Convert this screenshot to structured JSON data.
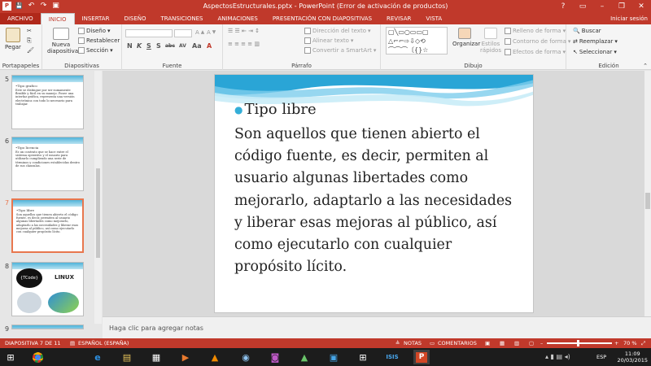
{
  "window": {
    "title": "AspectosEstructurales.pptx -  PowerPoint (Error de activación de productos)",
    "help": "?",
    "minimize": "–",
    "restore": "❐",
    "close": "✕"
  },
  "qat": {
    "save": "💾",
    "undo": "↶",
    "redo": "↷",
    "present": "▣"
  },
  "tabs": [
    {
      "label": "ARCHIVO",
      "kind": "file"
    },
    {
      "label": "INICIO",
      "kind": "active"
    },
    {
      "label": "INSERTAR",
      "kind": "normal"
    },
    {
      "label": "DISEÑO",
      "kind": "normal"
    },
    {
      "label": "TRANSICIONES",
      "kind": "normal"
    },
    {
      "label": "ANIMACIONES",
      "kind": "normal"
    },
    {
      "label": "PRESENTACIÓN CON DIAPOSITIVAS",
      "kind": "normal"
    },
    {
      "label": "REVISAR",
      "kind": "normal"
    },
    {
      "label": "VISTA",
      "kind": "normal"
    }
  ],
  "signin": "Iniciar sesión",
  "ribbon": {
    "clipboard": {
      "label": "Portapapeles",
      "paste": "Pegar"
    },
    "slides": {
      "label": "Diapositivas",
      "new_slide": "Nueva diapositiva",
      "layout": "Diseño",
      "reset": "Restablecer",
      "section": "Sección"
    },
    "font": {
      "label": "Fuente",
      "bold": "N",
      "italic": "K",
      "underline": "S",
      "shadow": "S",
      "strike": "abc",
      "spacing": "AV",
      "case": "Aa",
      "color": "A"
    },
    "paragraph": {
      "label": "Párrafo",
      "text_direction": "Dirección del texto",
      "align_text": "Alinear texto",
      "smartart": "Convertir a SmartArt"
    },
    "drawing": {
      "label": "Dibujo",
      "arrange": "Organizar",
      "quick_styles": "Estilos rápidos",
      "fill": "Relleno de forma",
      "outline": "Contorno de forma",
      "effects": "Efectos de forma"
    },
    "editing": {
      "label": "Edición",
      "find": "Buscar",
      "replace": "Reemplazar",
      "select": "Seleccionar"
    }
  },
  "thumbnails": [
    {
      "num": "5",
      "title": "•Tipo grafico",
      "text": "Este se distingue por ser sumamente flexible y fácil en su manejo. Posee una interfaz gráfica, representa una versión electrónica con todo lo necesario para trabajar."
    },
    {
      "num": "6",
      "title": "•Tipo licencia",
      "text": "Es un contrato que se hace entre el sistema operativo y el usuario para utilizarlo cumpliendo una serie de términos y condiciones establecidas dentro de sus clausulas."
    },
    {
      "num": "7",
      "title": "•Tipo libre",
      "text": "Son aquellos que tienen abierto el código fuente, es decir, permiten al usuario algunas libertades como mejorarlo, adaptarlo a las necesidades y liberar esas mejoras al público, así como ejecutarlo con cualquier propósito lícito."
    },
    {
      "num": "8",
      "title": "",
      "text": ""
    },
    {
      "num": "9",
      "title": "",
      "text": ""
    }
  ],
  "thumb8": {
    "logo_text": "{TCode}",
    "linux": "LINUX"
  },
  "slide": {
    "title": "Tipo libre",
    "body": "Son aquellos que tienen abierto el código fuente, es decir, permiten al usuario algunas libertades como mejorarlo, adaptarlo a las necesidades y liberar esas mejoras al público, así como ejecutarlo con cualquier propósito lícito."
  },
  "notes_placeholder": "Haga clic para agregar notas",
  "status": {
    "slide_info": "DIAPOSITIVA 7 DE 11",
    "language": "ESPAÑOL (ESPAÑA)",
    "notes": "NOTAS",
    "comments": "COMENTARIOS",
    "zoom": "70 %",
    "zoom_percent": 48
  },
  "taskbar": {
    "apps": [
      "chrome-icon",
      "ie-icon",
      "files-icon",
      "film-icon",
      "media-icon",
      "vlc-icon",
      "webcam-icon",
      "camera-icon",
      "chart-icon",
      "cisco-icon",
      "network-icon",
      "powerpoint-icon"
    ],
    "language": "ESP",
    "time": "11:09",
    "date": "20/03/2015"
  },
  "colors": {
    "accent": "#c0392b",
    "bullet": "#34aed8"
  }
}
